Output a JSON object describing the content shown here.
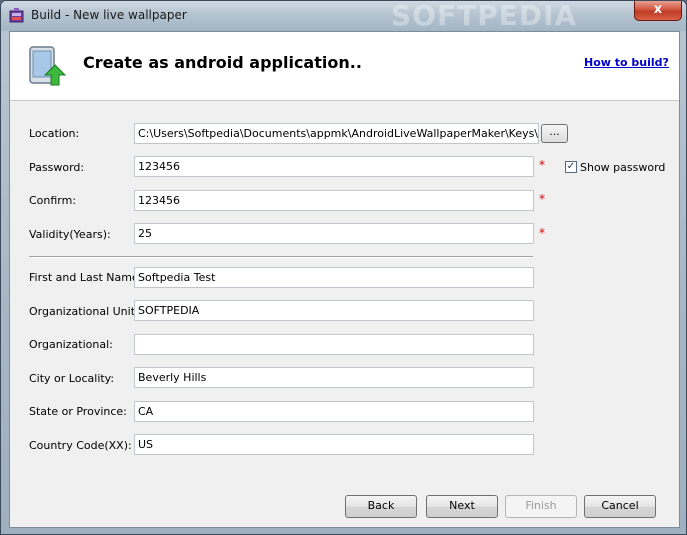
{
  "window": {
    "title": "Build - New live wallpaper",
    "watermark": "SOFTPEDIA",
    "close_glyph": "x"
  },
  "header": {
    "title": "Create as android application..",
    "help_link": "How to build?"
  },
  "form": {
    "location_label": "Location:",
    "location_value": "C:\\Users\\Softpedia\\Documents\\appmk\\AndroidLiveWallpaperMaker\\Keys\\default.k",
    "browse_label": "...",
    "password_label": "Password:",
    "password_value": "123456",
    "confirm_label": "Confirm:",
    "confirm_value": "123456",
    "validity_label": "Validity(Years):",
    "validity_value": "25",
    "show_password_label": "Show password",
    "show_password_checked": true,
    "required_mark": "*",
    "first_last_label": "First and Last Name:",
    "first_last_value": "Softpedia Test",
    "org_unit_label": "Organizational Unit:",
    "org_unit_value": "SOFTPEDIA",
    "organizational_label": "Organizational:",
    "organizational_value": "",
    "city_label": "City or Locality:",
    "city_value": "Beverly Hills",
    "state_label": "State or Province:",
    "state_value": "CA",
    "country_label": "Country Code(XX):",
    "country_value": "US"
  },
  "buttons": {
    "back": "Back",
    "next": "Next",
    "finish": "Finish",
    "cancel": "Cancel"
  },
  "colors": {
    "link": "#0000cc",
    "required": "#dd0000",
    "close_button": "#c8442c"
  }
}
